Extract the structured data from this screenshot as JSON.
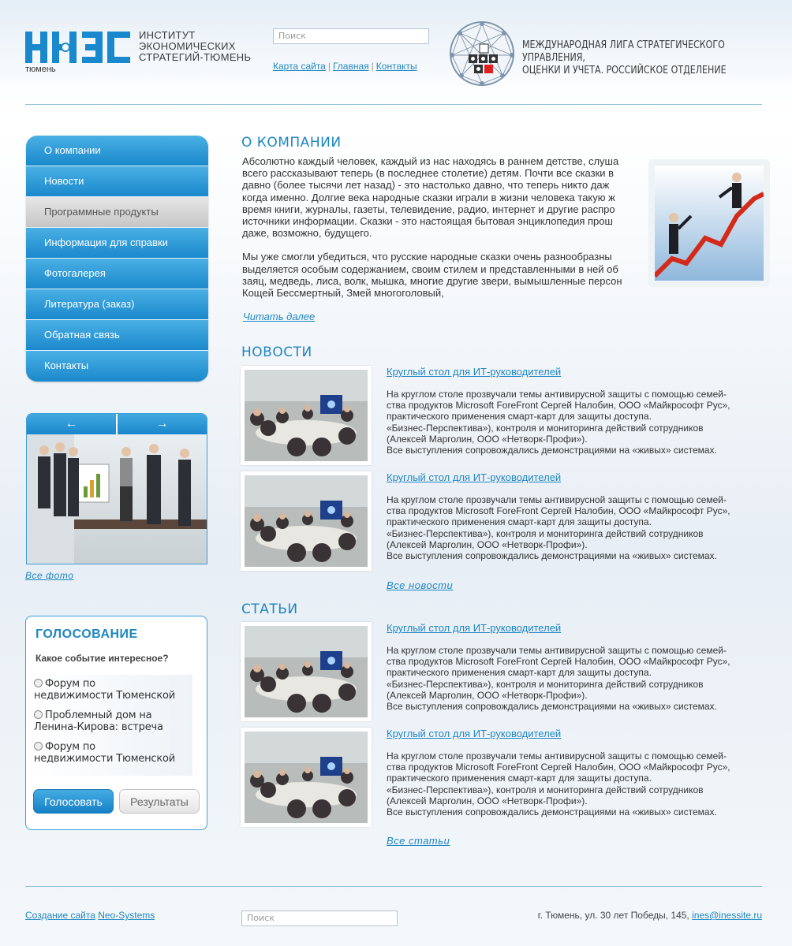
{
  "header": {
    "logo_text": "ИНЭС",
    "logo_city": "тюмень",
    "institute_lines": [
      "ИНСТИТУТ",
      "ЭКОНОМИЧЕСКИХ",
      "СТРАТЕГИЙ-ТЮМЕНЬ"
    ],
    "search_placeholder": "Поиск",
    "links": [
      "Карта сайта",
      "Главная",
      "Контакты"
    ],
    "league_lines": [
      "МЕЖДУНАРОДНАЯ ЛИГА СТРАТЕГИЧЕСКОГО УПРАВЛЕНИЯ,",
      "ОЦЕНКИ И УЧЕТА. РОССИЙСКОЕ ОТДЕЛЕНИЕ"
    ]
  },
  "nav": {
    "items": [
      "О компании",
      "Новости",
      "Программные продукты",
      "Информация для справки",
      "Фотогалерея",
      "Литература (заказ)",
      "Обратная связь",
      "Контакты"
    ],
    "active_index": 2
  },
  "slider": {
    "prev": "←",
    "next": "→",
    "all_photos": "Все фото"
  },
  "poll": {
    "title": "ГОЛОСОВАНИЕ",
    "question": "Какое событие интересное?",
    "options": [
      [
        "Форум по",
        "недвижимости Тюменской"
      ],
      [
        "Проблемный дом на",
        "Ленина-Кирова: встреча"
      ],
      [
        "Форум по",
        "недвижимости Тюменской"
      ]
    ],
    "vote_label": "Голосовать",
    "results_label": "Результаты"
  },
  "about": {
    "title": "О КОМПАНИИ",
    "para1": [
      "Абсолютно каждый человек, каждый из нас находясь в раннем детстве, слуша",
      "всего рассказывают теперь (в последнее столетие) детям. Почти все сказки в",
      "давно (более тысячи лет назад) - это настолько давно, что теперь никто даж",
      "когда именно. Долгие века народные сказки играли в жизни человека такую ж",
      "время книги, журналы, газеты, телевидение, радио, интернет и другие распро",
      "источники информации. Сказки - это настоящая бытовая энциклопедия прош",
      "даже, возможно, будущего."
    ],
    "para2": [
      "Мы уже смогли убедиться, что русские народные сказки очень разнообразны",
      "выделяется особым содержанием, своим стилем и представленными в ней об",
      "заяц, медведь, лиса, волк, мышка, многие другие звери, вымышленные персон",
      "Кощей Бессмертный, Змей многоголовый,"
    ],
    "read_more": "Читать далее"
  },
  "news": {
    "title": "НОВОСТИ",
    "items": [
      {
        "title": "Круглый стол для ИТ-руководителей",
        "lines": [
          "На круглом столе прозвучали темы антивирусной защиты с помощью семей-",
          "ства продуктов Microsoft ForeFront Сергей Налобин, ООО «Майкрософт Рус»,",
          "практического применения смарт-карт для защиты доступа.",
          "«Бизнес-Перспектива»), контроля и мониторинга действий сотрудников",
          "(Алексей Марголин, ООО «Нетворк-Профи»).",
          "Все выступления сопровождались демонстрациями на «живых» системах."
        ]
      },
      {
        "title": "Круглый стол для ИТ-руководителей",
        "lines": [
          "На круглом столе прозвучали темы антивирусной защиты с помощью семей-",
          "ства продуктов Microsoft ForeFront Сергей Налобин, ООО «Майкрософт Рус»,",
          "практического применения смарт-карт для защиты доступа.",
          "«Бизнес-Перспектива»), контроля и мониторинга действий сотрудников",
          "(Алексей Марголин, ООО «Нетворк-Профи»).",
          "Все выступления сопровождались демонстрациями на «живых» системах."
        ]
      }
    ],
    "all_label": "Все новости"
  },
  "articles": {
    "title": "СТАТЬИ",
    "items": [
      {
        "title": "Круглый стол для ИТ-руководителей",
        "lines": [
          "На круглом столе прозвучали темы антивирусной защиты с помощью семей-",
          "ства продуктов Microsoft ForeFront Сергей Налобин, ООО «Майкрософт Рус»,",
          "практического применения смарт-карт для защиты доступа.",
          "«Бизнес-Перспектива»), контроля и мониторинга действий сотрудников",
          "(Алексей Марголин, ООО «Нетворк-Профи»).",
          "Все выступления сопровождались демонстрациями на «живых» системах."
        ]
      },
      {
        "title": "Круглый стол для ИТ-руководителей",
        "lines": [
          "На круглом столе прозвучали темы антивирусной защиты с помощью семей-",
          "ства продуктов Microsoft ForeFront Сергей Налобин, ООО «Майкрософт Рус»,",
          "практического применения смарт-карт для защиты доступа.",
          "«Бизнес-Перспектива»), контроля и мониторинга действий сотрудников",
          "(Алексей Марголин, ООО «Нетворк-Профи»).",
          "Все выступления сопровождались демонстрациями на «живых» системах."
        ]
      }
    ],
    "all_label": "Все статьи"
  },
  "footer": {
    "created_label": "Создание сайта",
    "developer": "Neo-Systems",
    "search_placeholder": "Поиск",
    "address": "г. Тюмень, ул. 30 лет Победы, 145,",
    "email": "ines@inessite.ru"
  },
  "colors": {
    "accent": "#1f86c2",
    "nav_blue": "#1a88cc",
    "active_gray": "#c6c6c6",
    "divider": "#8fc5d8"
  }
}
